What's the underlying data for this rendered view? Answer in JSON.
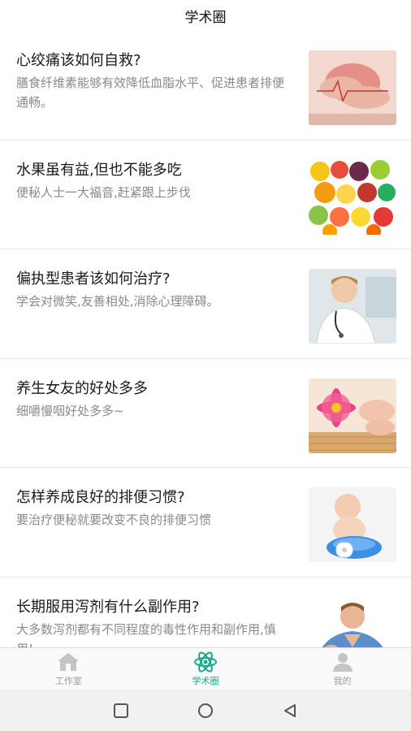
{
  "header": {
    "title": "学术圈"
  },
  "articles": [
    {
      "title": "心绞痛该如何自救?",
      "desc": "膳食纤维素能够有效降低血脂水平、促进患者排便通畅。",
      "image": "chest-pain-photo"
    },
    {
      "title": "水果虽有益,但也不能多吃",
      "desc": "便秘人士一大福音,赶紧跟上步伐",
      "image": "fruits-photo"
    },
    {
      "title": "偏执型患者该如何治疗?",
      "desc": "学会对微笑,友善相处,消除心理障碍。",
      "image": "doctor-photo"
    },
    {
      "title": "养生女友的好处多多",
      "desc": "细嚼慢咽好处多多~",
      "image": "flower-spa-photo"
    },
    {
      "title": "怎样养成良好的排便习惯?",
      "desc": "要治疗便秘就要改变不良的排便习惯",
      "image": "baby-potty-photo"
    },
    {
      "title": "长期服用泻剂有什么副作用?",
      "desc": "大多数泻剂都有不同程度的毒性作用和副作用,慎用!",
      "image": "man-pain-photo"
    }
  ],
  "tabbar": {
    "tabs": [
      {
        "label": "工作室",
        "icon": "house-icon",
        "active": false
      },
      {
        "label": "学术圈",
        "icon": "atom-icon",
        "active": true
      },
      {
        "label": "我的",
        "icon": "person-icon",
        "active": false
      }
    ]
  },
  "colors": {
    "accent": "#1aa58d",
    "inactive": "#9c9c9c"
  }
}
